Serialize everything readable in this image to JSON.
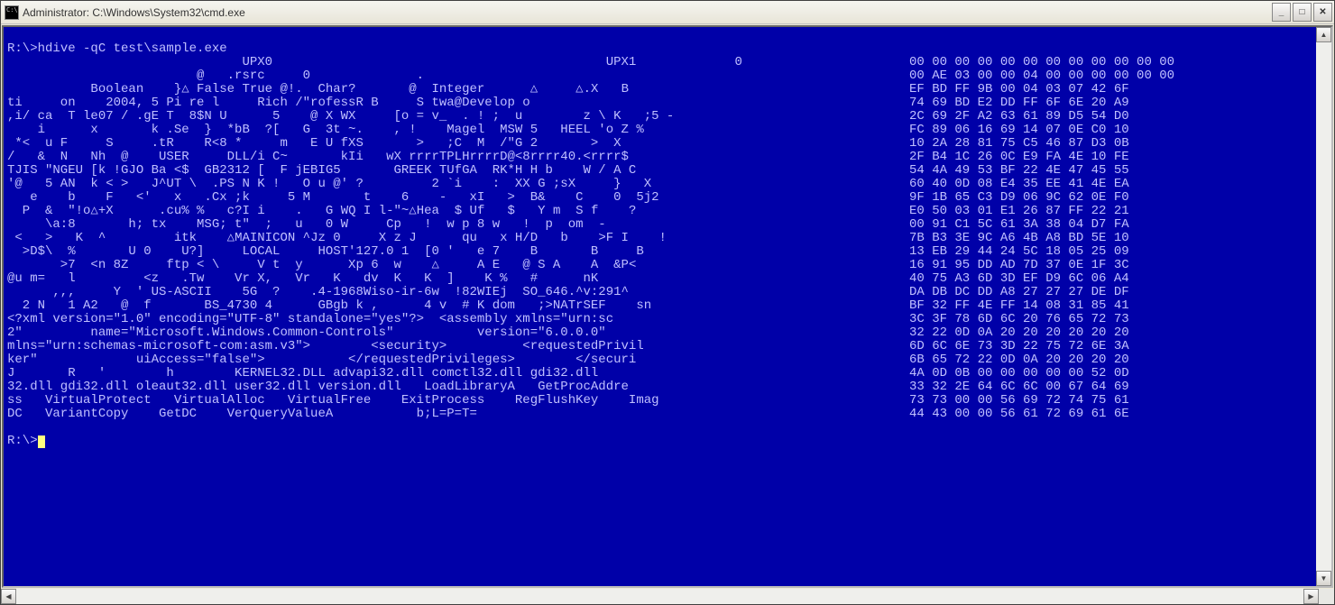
{
  "window": {
    "title": "Administrator: C:\\Windows\\System32\\cmd.exe"
  },
  "prompt1": "R:\\>",
  "command": "hdive -qC test\\sample.exe",
  "prompt2": "R:\\>",
  "lines": [
    {
      "left": "                               UPX0                                            UPX1             0",
      "right": "00 00 00 00 00 00 00 00 00 00 00 00"
    },
    {
      "left": "                         @   .rsrc     0              .",
      "right": "00 AE 03 00 00 04 00 00 00 00 00 00"
    },
    {
      "left": "           Boolean    }△ False True @!.  Char?       @  Integer      △     △.X   B",
      "right": "EF BD FF 9B 00 04 03 07 42 6F"
    },
    {
      "left": "ti     on    2004, 5 Pi re l     Rich /\"rofessR B     S twa@Develop o",
      "right": "74 69 BD E2 DD FF 6F 6E 20 A9"
    },
    {
      "left": ",i/ ca  T le07 / .gE T  8$N U      5    @ X WX     [o = v_  . ! ;  u        z \\ K   ;5 -",
      "right": "2C 69 2F A2 63 61 89 D5 54 D0"
    },
    {
      "left": "    i      x       k .Se  }  *bB  ?[   G  3t ~.    , !    Magel  MSW 5   HEEL 'o Z %",
      "right": "FC 89 06 16 69 14 07 0E C0 10"
    },
    {
      "left": " *<  u F     S     .tR    R<8 *     m   E U fXS       >   ;C  M  /\"G 2       >  X",
      "right": "10 2A 28 81 75 C5 46 87 D3 0B"
    },
    {
      "left": "/   &  N   Nh  @    USER     DLL/i C~       kIi   wX rrrrTPLHrrrrD@<8rrrr40.<rrrr$",
      "right": "2F B4 1C 26 0C E9 FA 4E 10 FE"
    },
    {
      "left": "TJIS \"NGEU [k !GJO Ba <$  GB2312 [  F jEBIG5       GREEK TUfGA  RK*H H b    W / A C",
      "right": "54 4A 49 53 BF 22 4E 47 45 55"
    },
    {
      "left": "'@   5 AN  k < >   J^UT \\  .PS N K !   O u @' ?         2 `i    :  XX G ;sX     }   X",
      "right": "60 40 0D 08 E4 35 EE 41 4E EA"
    },
    {
      "left": "   e    b    F   <'   x   .Cx ;k     5 M       t    6    -   xI   >  B&    C    0  5j2",
      "right": "9F 1B 65 C3 D9 06 9C 62 0E F0"
    },
    {
      "left": "  P  &  \"!o△+X      .cu% %   c?I i    .   G WQ I l-\"~△Hea  $ Uf   $   Y m  S f    ?",
      "right": "E0 50 03 01 E1 26 87 FF 22 21"
    },
    {
      "left": "     \\a:8       h; tx    MSG; t\"  ;   u   0 W     Cp   !  w p 8 w   !  p  om  -",
      "right": "00 91 C1 5C 61 3A 38 04 D7 FA"
    },
    {
      "left": " <   >   K  ^         itk    △MAINICON ^Jz 0     X z J      qu   x H/D   b    >F I    !",
      "right": "7B B3 3E 9C A6 4B A8 BD 5E 10"
    },
    {
      "left": "  >D$\\  %       U 0    U?]     LOCAL     HOST'127.0 1  [0 '   e 7    B       B     B",
      "right": "13 EB 29 44 24 5C 18 05 25 09"
    },
    {
      "left": "       >7  <n 8Z     ftp < \\     V t  y      Xp 6  w    △     A E   @ S A    A  &P<",
      "right": "16 91 95 DD AD 7D 37 0E 1F 3C"
    },
    {
      "left": "@u m=   l         <z   .Tw    Vr X,   Vr   K   dv  K   K  ]    K %   #      nK",
      "right": "40 75 A3 6D 3D EF D9 6C 06 A4"
    },
    {
      "left": "      ,,,     Y  ' US-ASCII    5G  ?    .4-1968Wiso-ir-6w  !82WIEj  SO_646.^v:291^",
      "right": "DA DB DC DD A8 27 27 27 DE DF"
    },
    {
      "left": "  2 N   1 A2   @  f       BS_4730 4      GBgb k ,      4 v  # K dom   ;>NATrSEF    sn",
      "right": "BF 32 FF 4E FF 14 08 31 85 41"
    },
    {
      "left": "<?xml version=\"1.0\" encoding=\"UTF-8\" standalone=\"yes\"?>  <assembly xmlns=\"urn:sc",
      "right": "3C 3F 78 6D 6C 20 76 65 72 73"
    },
    {
      "left": "2\"         name=\"Microsoft.Windows.Common-Controls\"           version=\"6.0.0.0\"",
      "right": "32 22 0D 0A 20 20 20 20 20 20"
    },
    {
      "left": "mlns=\"urn:schemas-microsoft-com:asm.v3\">        <security>          <requestedPrivil",
      "right": "6D 6C 6E 73 3D 22 75 72 6E 3A"
    },
    {
      "left": "ker\"             uiAccess=\"false\">           </requestedPrivileges>        </securi",
      "right": "6B 65 72 22 0D 0A 20 20 20 20"
    },
    {
      "left": "J       R   '        h        KERNEL32.DLL advapi32.dll comctl32.dll gdi32.dll",
      "right": "4A 0D 0B 00 00 00 00 00 52 0D"
    },
    {
      "left": "32.dll gdi32.dll oleaut32.dll user32.dll version.dll   LoadLibraryA   GetProcAddre",
      "right": "33 32 2E 64 6C 6C 00 67 64 69"
    },
    {
      "left": "ss   VirtualProtect   VirtualAlloc   VirtualFree    ExitProcess    RegFlushKey    Imag",
      "right": "73 73 00 00 56 69 72 74 75 61"
    },
    {
      "left": "DC   VariantCopy    GetDC    VerQueryValueA           b;L=P=T=",
      "right": "44 43 00 00 56 61 72 69 61 6E"
    }
  ]
}
